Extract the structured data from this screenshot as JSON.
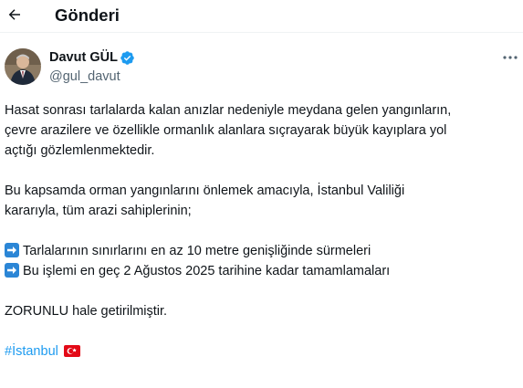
{
  "header": {
    "title": "Gönderi"
  },
  "author": {
    "name": "Davut GÜL",
    "handle": "@gul_davut"
  },
  "tweet": {
    "lines": [
      "Hasat sonrası tarlalarda kalan anızlar nedeniyle meydana gelen yangınların,",
      "çevre arazilere ve özellikle ormanlık alanlara sıçrayarak büyük kayıplara yol",
      "açtığı gözlemlenmektedir.",
      "Bu kapsamda orman yangınlarını önlemek amacıyla, İstanbul Valiliği",
      "kararıyla, tüm arazi sahiplerinin;",
      "Tarlalarının sınırlarını en az 10 metre genişliğinde sürmeleri",
      "Bu işlemi en geç 2 Ağustos 2025 tarihine kadar tamamlamaları",
      "ZORUNLU hale getirilmiştir.",
      "#İstanbul"
    ]
  },
  "icons": {
    "back": "arrow-left-icon",
    "verified": "verified-badge-icon",
    "more": "more-horizontal-icon",
    "bullet": "arrow-right-emoji",
    "flag": "turkey-flag-emoji"
  },
  "colors": {
    "accent": "#1d9bf0",
    "secondary_text": "#536471",
    "bullet_blue": "#2b86d6",
    "flag_red": "#e30a17"
  }
}
